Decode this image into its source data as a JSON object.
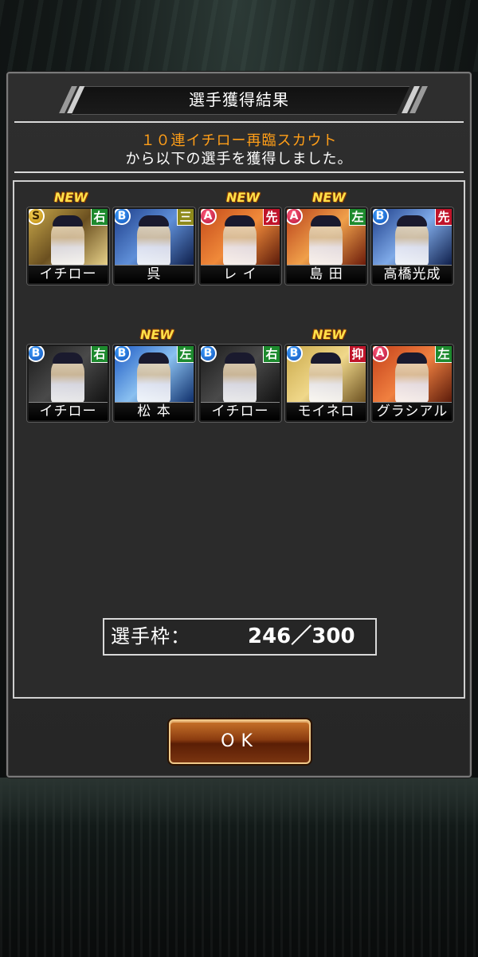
{
  "dialog": {
    "title": "選手獲得結果",
    "scout_name": "１０連イチロー再臨スカウト",
    "message": "から以下の選手を獲得しました。"
  },
  "players": [
    {
      "name": "イチロー",
      "rank": "S",
      "position": "右",
      "position_color": "green",
      "is_new": true,
      "new_label": "NEW"
    },
    {
      "name": "呉",
      "rank": "B",
      "position": "三",
      "position_color": "olive",
      "is_new": false,
      "new_label": ""
    },
    {
      "name": "レ イ",
      "rank": "A",
      "position": "先",
      "position_color": "red",
      "is_new": true,
      "new_label": "NEW"
    },
    {
      "name": "島 田",
      "rank": "A",
      "position": "左",
      "position_color": "green",
      "is_new": true,
      "new_label": "NEW"
    },
    {
      "name": "高橋光成",
      "rank": "B",
      "position": "先",
      "position_color": "red",
      "is_new": false,
      "new_label": ""
    },
    {
      "name": "イチロー",
      "rank": "B",
      "position": "右",
      "position_color": "green",
      "is_new": false,
      "new_label": ""
    },
    {
      "name": "松 本",
      "rank": "B",
      "position": "左",
      "position_color": "green",
      "is_new": true,
      "new_label": "NEW"
    },
    {
      "name": "イチロー",
      "rank": "B",
      "position": "右",
      "position_color": "green",
      "is_new": false,
      "new_label": ""
    },
    {
      "name": "モイネロ",
      "rank": "B",
      "position": "抑",
      "position_color": "red",
      "is_new": true,
      "new_label": "NEW"
    },
    {
      "name": "グラシアル",
      "rank": "A",
      "position": "左",
      "position_color": "green",
      "is_new": false,
      "new_label": ""
    }
  ],
  "roster": {
    "label": "選手枠：",
    "value": "246／300"
  },
  "ok_button": {
    "label": "OK"
  },
  "colors": {
    "scout_text": "#ff9e18",
    "ok_button": "#8b3c10",
    "rank_S": "#d4a017",
    "rank_A": "#d81e47",
    "rank_B": "#1e6fd8"
  }
}
